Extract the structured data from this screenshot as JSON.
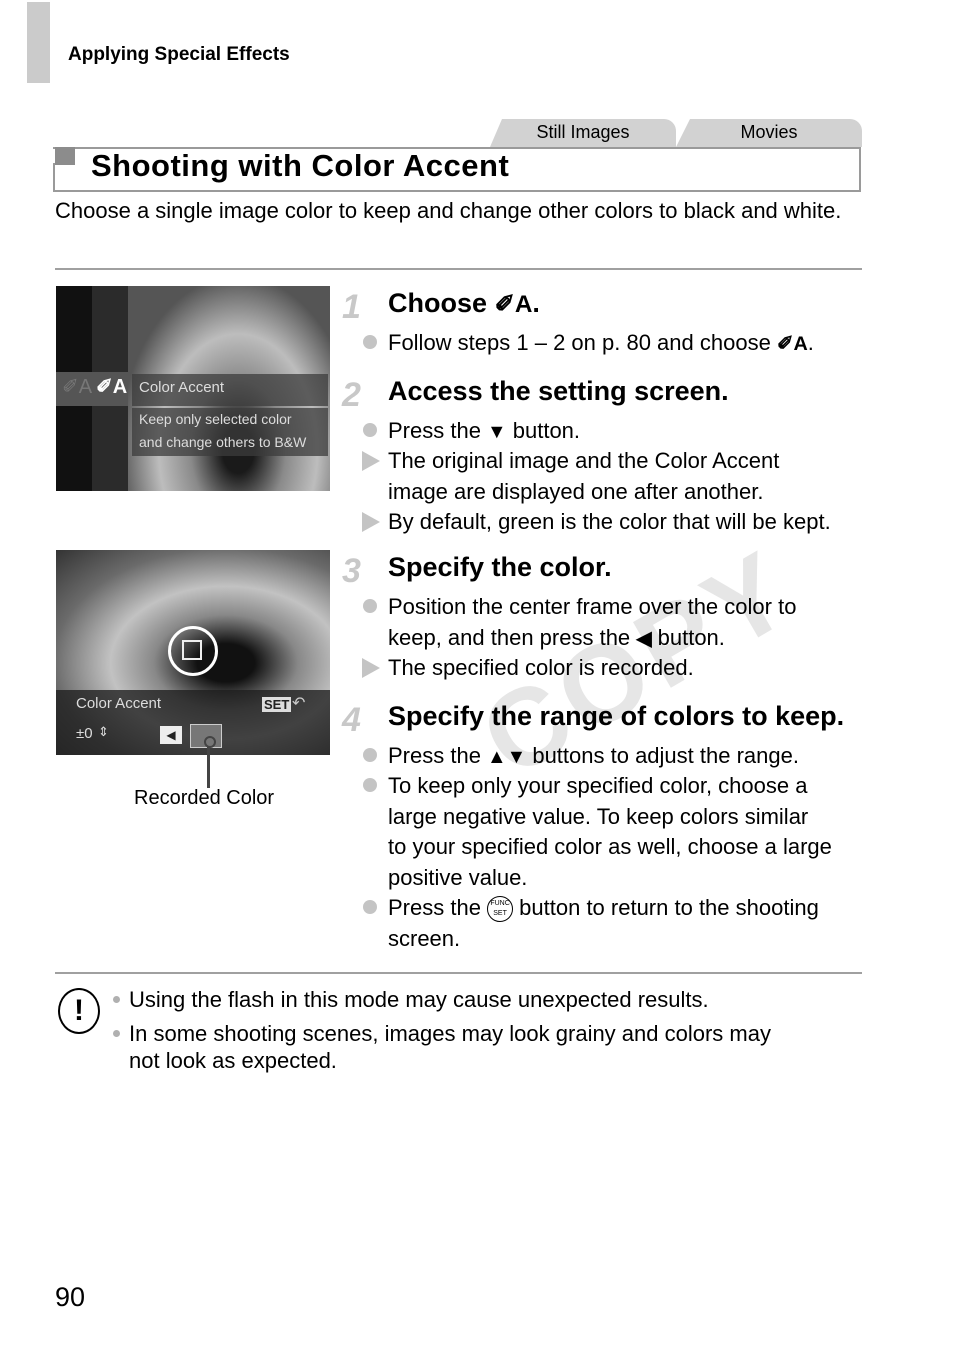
{
  "header": {
    "section": "Applying Special Effects"
  },
  "tabs": [
    {
      "label": "Still Images"
    },
    {
      "label": "Movies"
    }
  ],
  "title": "Shooting with Color Accent",
  "intro": "Choose a single image color to keep and change other colors to black and white.",
  "watermark": "COPY",
  "screen1": {
    "menu_title": "Color Accent",
    "menu_desc_1": "Keep only selected color",
    "menu_desc_2": "and change others to B&W",
    "icon_glyph": "✐A"
  },
  "screen2": {
    "label": "Color Accent",
    "set_label": "SET",
    "range_value": "±0",
    "caption": "Recorded Color"
  },
  "steps": [
    {
      "num": "1",
      "title_prefix": "Choose ",
      "title_icon": "✐A",
      "title_suffix": ".",
      "lines": [
        {
          "type": "dot",
          "text_prefix": "Follow steps 1 – 2 on p. 80 and choose ",
          "icon": "✐A",
          "text_suffix": "."
        }
      ]
    },
    {
      "num": "2",
      "title": "Access the setting screen.",
      "lines": [
        {
          "type": "dot",
          "text_prefix": "Press the ",
          "icon": "▼",
          "text_suffix": " button."
        },
        {
          "type": "tri",
          "text": "The original image and the Color Accent"
        },
        {
          "type": "cont",
          "text": "image are displayed one after another."
        },
        {
          "type": "tri",
          "text": "By default, green is the color that will be kept."
        }
      ]
    },
    {
      "num": "3",
      "title": "Specify the color.",
      "lines": [
        {
          "type": "dot",
          "text": "Position the center frame over the color to"
        },
        {
          "type": "cont",
          "text_prefix": "keep, and then press the ",
          "icon": "◀",
          "text_suffix": " button."
        },
        {
          "type": "tri",
          "text": "The specified color is recorded."
        }
      ]
    },
    {
      "num": "4",
      "title": "Specify the range of colors to keep.",
      "lines": [
        {
          "type": "dot",
          "text_prefix": "Press the ",
          "icon": "▲▼",
          "text_suffix": " buttons to adjust the range."
        },
        {
          "type": "dot",
          "text": "To keep only your specified color, choose a"
        },
        {
          "type": "cont",
          "text": "large negative value. To keep colors similar"
        },
        {
          "type": "cont",
          "text": "to your specified color as well, choose a large"
        },
        {
          "type": "cont",
          "text": "positive value."
        },
        {
          "type": "dot",
          "text_prefix": "Press the ",
          "icon": "FUNC SET",
          "text_suffix": " button to return to the shooting"
        },
        {
          "type": "cont",
          "text": "screen."
        }
      ]
    }
  ],
  "notes": [
    {
      "text": "Using the flash in this mode may cause unexpected results."
    },
    {
      "text": "In some shooting scenes, images may look grainy and colors may"
    },
    {
      "text": "not look as expected."
    }
  ],
  "page_number": "90"
}
